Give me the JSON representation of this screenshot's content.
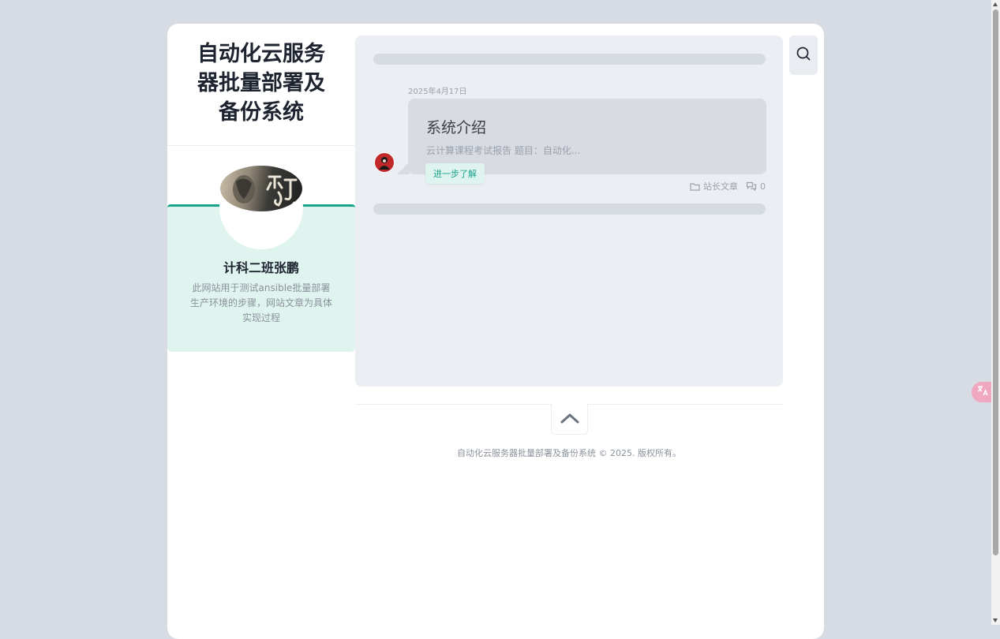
{
  "site": {
    "title": "自动化云服务器批量部署及备份系统"
  },
  "profile": {
    "name": "计科二班张鹏",
    "bio": "此网站用于测试ansible批量部署生产环境的步骤，网站文章为具体实现过程"
  },
  "post": {
    "date": "2025年4月17日",
    "title": "系统介绍",
    "excerpt": "云计算课程考试报告 题目：自动化...",
    "read_more_label": "进一步了解",
    "category": "站长文章",
    "comment_count": "0"
  },
  "footer": {
    "copyright": "自动化云服务器批量部署及备份系统 © 2025. 版权所有。"
  },
  "icons": {
    "search": "search-icon",
    "folder": "folder-icon",
    "comments": "comments-icon",
    "back_to_top": "chevron-up-icon",
    "translate": "translate-icon"
  },
  "colors": {
    "accent": "#19a38a",
    "profile_bg": "#dff3ef",
    "page_bg": "#d7dbe3",
    "translate_badge": "#f0a8c0"
  }
}
